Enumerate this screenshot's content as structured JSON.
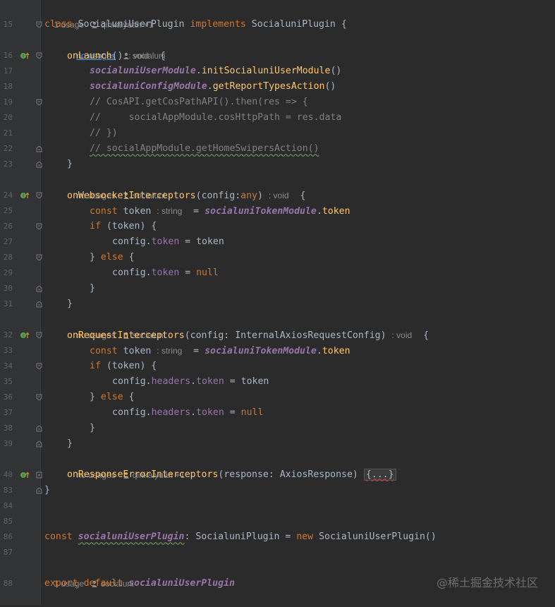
{
  "editor": {
    "hints": {
      "h1": {
        "usages": "1 usage",
        "author": "qinkaiyuan +1"
      },
      "h2": {
        "usages": "no usages",
        "author": "socialuni"
      },
      "h3": {
        "usages": "no usages",
        "author": "socialuni"
      },
      "h4": {
        "usages": "no usages",
        "author": "socialuni"
      },
      "h5": {
        "usages": "no usages",
        "author": "qinkaiyuan +1"
      },
      "h6": {
        "usages": "1 usage",
        "author": "socialuni"
      }
    },
    "lines": {
      "l15": {
        "num": "15",
        "t1": "class ",
        "t2": "SocialuniUserPlugin ",
        "t3": "implements ",
        "t4": "SocialuniPlugin {"
      },
      "l16": {
        "num": "16",
        "t1": "onLaunch",
        "t2": "() ",
        "t3": ": void",
        "t4": "  {"
      },
      "l17": {
        "num": "17",
        "t1": "socialuniUserModule",
        "t2": ".",
        "t3": "initSocialuniUserModule",
        "t4": "()"
      },
      "l18": {
        "num": "18",
        "t1": "socialuniConfigModule",
        "t2": ".",
        "t3": "getReportTypesAction",
        "t4": "()"
      },
      "l19": {
        "num": "19",
        "t1": "// CosAPI.getCosPathAPI().then(res => {"
      },
      "l20": {
        "num": "20",
        "t1": "//     socialAppModule.cosHttpPath = res.data"
      },
      "l21": {
        "num": "21",
        "t1": "// })"
      },
      "l22": {
        "num": "22",
        "t1": "// socialAppModule.getHomeSwipersAction()"
      },
      "l23": {
        "num": "23",
        "t1": "}"
      },
      "l24": {
        "num": "24",
        "t1": "onWebsocketInterceptors",
        "t2": "(config:",
        "t3": "any",
        "t4": ") ",
        "t5": ": void",
        "t6": "  {"
      },
      "l25": {
        "num": "25",
        "t1": "const ",
        "t2": "token ",
        "t3": ": string",
        "t4": "  = ",
        "t5": "socialuniTokenModule",
        "t6": ".",
        "t7": "token"
      },
      "l26": {
        "num": "26",
        "t1": "if ",
        "t2": "(token) {"
      },
      "l27": {
        "num": "27",
        "t1": "config.",
        "t2": "token",
        "t3": " = token"
      },
      "l28": {
        "num": "28",
        "t1": "} ",
        "t2": "else ",
        "t3": "{"
      },
      "l29": {
        "num": "29",
        "t1": "config.",
        "t2": "token",
        "t3": " = ",
        "t4": "null"
      },
      "l30": {
        "num": "30",
        "t1": "}"
      },
      "l31": {
        "num": "31",
        "t1": "}"
      },
      "l32": {
        "num": "32",
        "t1": "onRequestInterceptors",
        "t2": "(config: InternalAxiosRequestConfig) ",
        "t3": ": void",
        "t4": "  {"
      },
      "l33": {
        "num": "33",
        "t1": "const ",
        "t2": "token ",
        "t3": ": string",
        "t4": "  = ",
        "t5": "socialuniTokenModule",
        "t6": ".",
        "t7": "token"
      },
      "l34": {
        "num": "34",
        "t1": "if ",
        "t2": "(token) {"
      },
      "l35": {
        "num": "35",
        "t1": "config.",
        "t2": "headers",
        "t3": ".",
        "t4": "token",
        "t5": " = token"
      },
      "l36": {
        "num": "36",
        "t1": "} ",
        "t2": "else ",
        "t3": "{"
      },
      "l37": {
        "num": "37",
        "t1": "config.",
        "t2": "headers",
        "t3": ".",
        "t4": "token",
        "t5": " = ",
        "t6": "null"
      },
      "l38": {
        "num": "38",
        "t1": "}"
      },
      "l39": {
        "num": "39",
        "t1": "}"
      },
      "l40": {
        "num": "40",
        "t1": "onResponseErrorInterceptors",
        "t2": "(response: AxiosResponse) ",
        "t3": "{...}"
      },
      "l83": {
        "num": "83",
        "t1": "}"
      },
      "l84": {
        "num": "84"
      },
      "l85": {
        "num": "85"
      },
      "l86": {
        "num": "86",
        "t1": "const ",
        "t2": "socialuniUserPlugin",
        "t3": ": SocialuniPlugin = ",
        "t4": "new ",
        "t5": "SocialuniUserPlugin()"
      },
      "l87": {
        "num": "87"
      },
      "l88": {
        "num": "88",
        "t1": "export default ",
        "t2": "socialuniUserPlugin"
      }
    }
  },
  "watermark": "@稀土掘金技术社区",
  "colors": {
    "background": "#2b2b2b",
    "gutter": "#313335",
    "keyword": "#cc7832",
    "function": "#ffc66d",
    "field": "#9876aa",
    "comment": "#808080",
    "text": "#a9b7c6",
    "link": "#589df6",
    "marker_green": "#5a9f4a"
  },
  "icons": {
    "gutter_marker": "implements-method-icon",
    "author": "person-icon",
    "fold": "fold-icon"
  }
}
